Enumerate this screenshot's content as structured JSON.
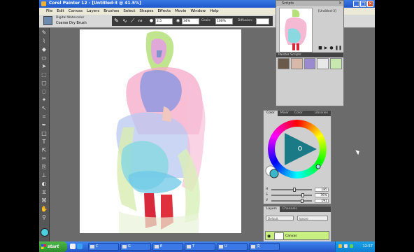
{
  "window": {
    "title": "Corel Painter 12 - [Untitled-3 @ 41.5%]",
    "controls": [
      "_",
      "□",
      "✕"
    ]
  },
  "menu": [
    "File",
    "Edit",
    "Canvas",
    "Layers",
    "Brushes",
    "Select",
    "Shapes",
    "Effects",
    "Movie",
    "Window",
    "Help"
  ],
  "property_bar": {
    "brush_category": "Digital Watercolor",
    "brush_variant": "Coarse Dry Brush",
    "size_value": "2.5",
    "opacity_value": "34%",
    "grain_label": "Grain:",
    "grain_value": "100%",
    "diffusion_label": "Diffusion:"
  },
  "scripts_panel": {
    "title": "Scripts",
    "script_name": "[Untitled-3]",
    "library_title": "Painter Scripts"
  },
  "color_panel": {
    "tabs": [
      "Color",
      "Mixer",
      "Color Sets",
      "Libraries"
    ],
    "accent": "#1a7a86",
    "sliders": [
      {
        "label": "H",
        "value": "185",
        "fraction": 0.55
      },
      {
        "label": "S",
        "value": "76%",
        "fraction": 0.76
      },
      {
        "label": "V",
        "value": "191",
        "fraction": 0.75
      }
    ]
  },
  "layers_panel": {
    "tabs": [
      "Layers",
      "Channels"
    ],
    "composite_method": "Default",
    "composite_depth": "Ignore",
    "layer_name": "Canvas"
  },
  "taskbar": {
    "start_label": "start",
    "buttons": [
      "C",
      "G",
      "E",
      "T",
      "U",
      "文"
    ],
    "clock": "12:57"
  }
}
